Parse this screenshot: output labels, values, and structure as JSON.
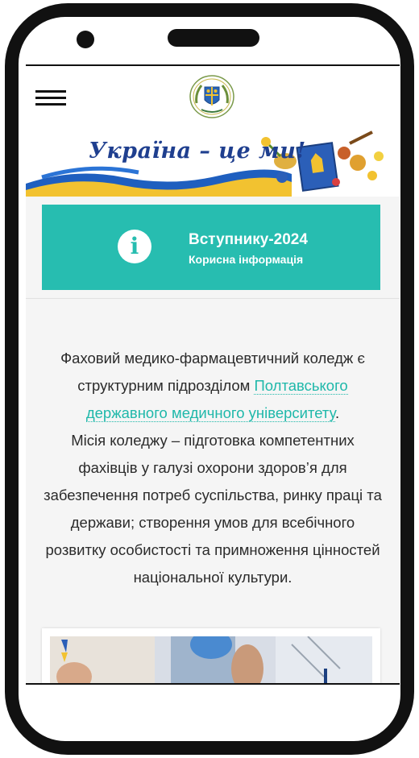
{
  "header": {
    "logo_label": "Logo"
  },
  "banner": {
    "text": "Україна – це ми!",
    "colors": {
      "blue": "#1f5fbf",
      "yellow": "#f2c230",
      "text": "#1f3f8f"
    }
  },
  "cta": {
    "title": "Вступнику-2024",
    "subtitle": "Корисна інформація",
    "icon": "info-icon",
    "color": "#27bdb0"
  },
  "about": {
    "line1_before": "Фаховий медико-фармацевтичний коледж є структурним підрозділом ",
    "link_text": "Полтавського державного медичного університету",
    "line1_after": ".",
    "mission": "Місія коледжу –  підготовка компетентних фахівців у галузі охорони здоров’я для забезпечення потреб суспільства, ринку праці та держави; створення умов для всебічного розвитку особистості та примноження цінностей національної культури."
  }
}
